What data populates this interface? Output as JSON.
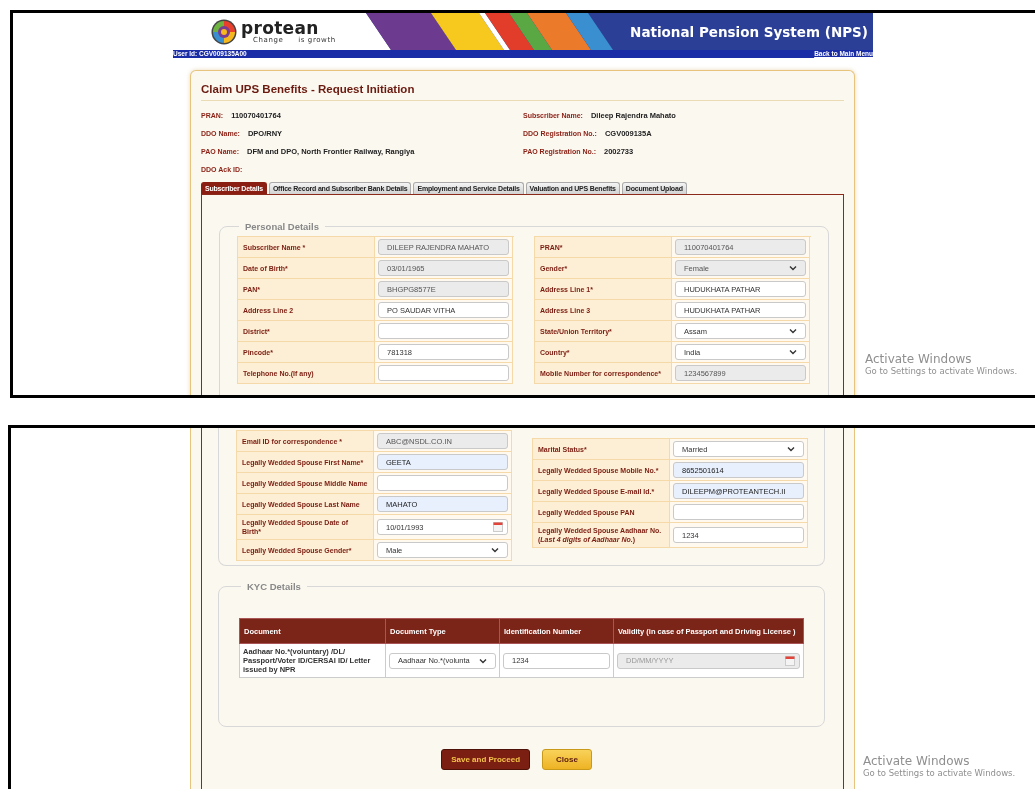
{
  "header": {
    "logo_text": "protean",
    "tagline": "Change *is* growth",
    "title": "National Pension System (NPS)"
  },
  "user_bar": {
    "user_id": "User Id: CGV009135A00",
    "back_link": "Back to Main Menu"
  },
  "page_title": "Claim UPS Benefits - Request Initiation",
  "info": [
    {
      "label": "PRAN:",
      "value": "110070401764"
    },
    {
      "label": "Subscriber Name:",
      "value": "Dileep Rajendra Mahato"
    },
    {
      "label": "DDO Name:",
      "value": "DPO/RNY"
    },
    {
      "label": "DDO Registration No.:",
      "value": "CGV009135A"
    },
    {
      "label": "PAO Name:",
      "value": "DFM and DPO, North Frontier Railway, Rangiya"
    },
    {
      "label": "PAO Registration No.:",
      "value": "2002733"
    },
    {
      "label": "DDO Ack ID:"
    }
  ],
  "tabs": [
    {
      "label": "Subscriber Details",
      "selected": true
    },
    {
      "label": "Office Record and Subscriber Bank Details",
      "selected": false
    },
    {
      "label": "Employment and Service Details",
      "selected": false
    },
    {
      "label": "Valuation and UPS Benefits",
      "selected": false
    },
    {
      "label": "Document Upload",
      "selected": false
    }
  ],
  "personal_details": {
    "legend": "Personal Details",
    "left": [
      {
        "label": "Subscriber Name *",
        "kind": "text",
        "value": "DILEEP RAJENDRA MAHATO",
        "readonly": true,
        "autofilled": false
      },
      {
        "label": "Date of Birth*",
        "kind": "text",
        "value": "03/01/1965",
        "readonly": true,
        "autofilled": false
      },
      {
        "label": "PAN*",
        "kind": "text",
        "value": "BHGPG8577E",
        "readonly": true,
        "autofilled": false
      },
      {
        "label": "Address Line 2",
        "kind": "text",
        "value": "PO SAUDAR VITHA",
        "readonly": false,
        "autofilled": false
      },
      {
        "label": "District*",
        "kind": "text",
        "readonly": false,
        "autofilled": false
      },
      {
        "label": "Pincode*",
        "kind": "text",
        "value": "781318",
        "readonly": false,
        "autofilled": false
      },
      {
        "label": "Telephone No.(If any)",
        "kind": "text",
        "readonly": false,
        "autofilled": false
      }
    ],
    "right": [
      {
        "label": "PRAN*",
        "kind": "text",
        "value": "110070401764",
        "readonly": true,
        "autofilled": false
      },
      {
        "label": "Gender*",
        "kind": "select",
        "value": "Female",
        "readonly": true,
        "autofilled": false
      },
      {
        "label": "Address Line 1*",
        "kind": "text",
        "value": "HUDUKHATA PATHAR",
        "readonly": false,
        "autofilled": false
      },
      {
        "label": "Address Line 3",
        "kind": "text",
        "value": "HUDUKHATA PATHAR",
        "readonly": false,
        "autofilled": false
      },
      {
        "label": "State/Union Territory*",
        "kind": "select",
        "value": "Assam",
        "readonly": false,
        "autofilled": false
      },
      {
        "label": "Country*",
        "kind": "select",
        "value": "India",
        "readonly": false,
        "autofilled": false
      },
      {
        "label": "Mobile Number for correspondence*",
        "kind": "text",
        "value": "1234567899",
        "readonly": true,
        "autofilled": false
      }
    ]
  },
  "personal_details_continued": {
    "left": [
      {
        "label": "Email ID for correspondence *",
        "kind": "text",
        "value": "ABC@NSDL.CO.IN",
        "readonly": true,
        "autofilled": false
      },
      {
        "label": "Legally Wedded Spouse First Name*",
        "kind": "text",
        "value": "GEETA",
        "readonly": false,
        "autofilled": true
      },
      {
        "label": "Legally Wedded Spouse Middle Name",
        "kind": "text",
        "readonly": false,
        "autofilled": false
      },
      {
        "label": "Legally Wedded Spouse Last Name",
        "kind": "text",
        "value": "MAHATO",
        "readonly": false,
        "autofilled": true
      },
      {
        "label": "Legally Wedded Spouse Date of Birth*",
        "kind": "date",
        "value": "10/01/1993",
        "readonly": false,
        "autofilled": false
      },
      {
        "label": "Legally Wedded Spouse Gender*",
        "kind": "select",
        "value": "Male",
        "readonly": false,
        "autofilled": false
      }
    ],
    "right": [
      {
        "label": "Marital Status*",
        "kind": "select",
        "value": "Married",
        "readonly": false,
        "autofilled": false
      },
      {
        "label": "Legally Wedded Spouse Mobile No.*",
        "kind": "text",
        "value": "8652501614",
        "readonly": false,
        "autofilled": true
      },
      {
        "label": "Legally Wedded Spouse E-mail Id.*",
        "kind": "text",
        "value": "DILEEPM@PROTEANTECH.II",
        "readonly": false,
        "autofilled": true
      },
      {
        "label": "Legally Wedded Spouse PAN",
        "kind": "text",
        "readonly": false,
        "autofilled": false
      },
      {
        "label": "Legally Wedded Spouse Aadhaar No.(*Last 4 digits of Aadhaar No.*)",
        "kind": "text",
        "value": "1234",
        "readonly": false,
        "autofilled": false
      }
    ]
  },
  "kyc": {
    "legend": "KYC Details",
    "columns": [
      "Document",
      "Document Type",
      "Identification Number",
      "Validity (in case of Passport and Driving License )"
    ],
    "rows": [
      [
        {
          "kind": "cell",
          "value": "Aadhaar No.*(voluntary) /DL/ Passport/Voter ID/CERSAI ID/ Letter issued by NPR"
        },
        {
          "kind": "select",
          "value": "Aadhaar No.*(volunta",
          "readonly": false,
          "autofilled": false
        },
        {
          "kind": "text",
          "value": "1234",
          "readonly": false,
          "autofilled": false
        },
        {
          "kind": "date",
          "placeholder": "DD/MM/YYYY",
          "readonly": true,
          "autofilled": false
        }
      ]
    ]
  },
  "buttons": [
    {
      "label": "Save and Proceed",
      "kind": "primary"
    },
    {
      "label": "Close",
      "kind": "secondary"
    }
  ],
  "os_notices": [
    {
      "title": "Activate Windows",
      "text": "Go to Settings to activate Windows."
    },
    {
      "title": "Activate Windows",
      "text": "Go to Settings to activate Windows."
    }
  ]
}
